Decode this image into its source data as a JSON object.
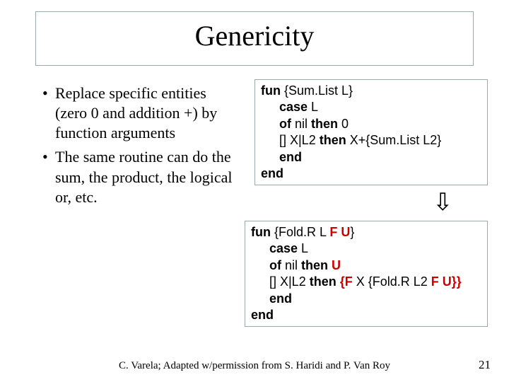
{
  "title": "Genericity",
  "bullets": [
    "Replace specific entities (zero 0 and addition +) by function arguments",
    "The same routine can do the sum, the product, the logical or, etc."
  ],
  "code1": {
    "l1a": "fun",
    "l1b": " {Sum.List L}",
    "l2a": "case",
    "l2b": " L",
    "l3a": "of",
    "l3b": "   nil ",
    "l3c": "then",
    "l3d": " 0",
    "l4a": "[]   X|L2 ",
    "l4b": "then",
    "l4c": " X+{Sum.List L2}",
    "l5": "end",
    "l6": "end"
  },
  "code2": {
    "l1a": "fun",
    "l1b": " {Fold.R L ",
    "l1c": "F U",
    "l1d": "}",
    "l2a": "case",
    "l2b": " L",
    "l3a": "of",
    "l3b": "   nil ",
    "l3c": "then",
    "l3d": " ",
    "l3e": "U",
    "l4a": "[]   X|L2 ",
    "l4b": "then",
    "l4c": " ",
    "l4d": "{F",
    "l4e": " X  {Fold.R L2 ",
    "l4f": "F U}}",
    "l5": "end",
    "l6": "end"
  },
  "arrow_glyph": "⇩",
  "footer": "C. Varela; Adapted w/permission from S. Haridi and P. Van Roy",
  "page_number": "21"
}
